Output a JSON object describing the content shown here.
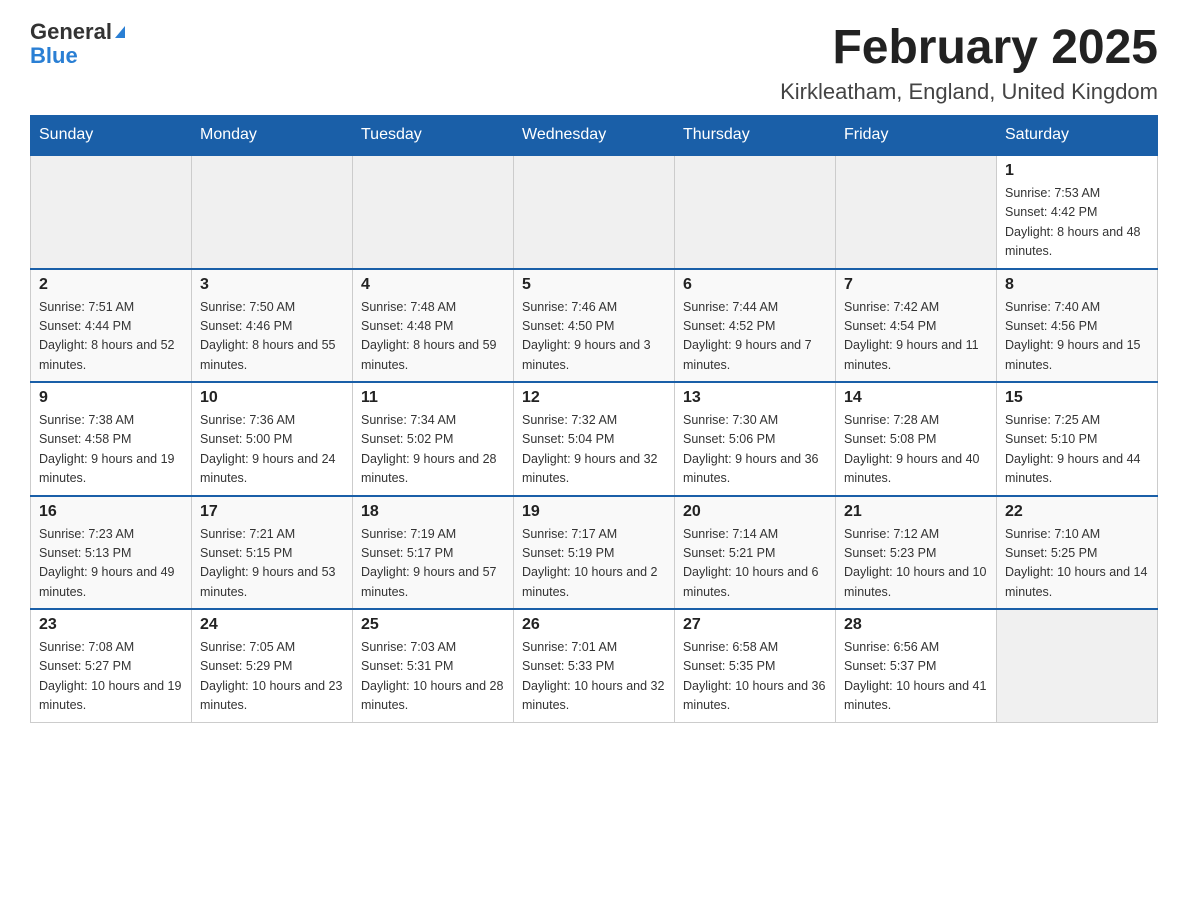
{
  "header": {
    "logo_general": "General",
    "logo_blue": "Blue",
    "title": "February 2025",
    "subtitle": "Kirkleatham, England, United Kingdom"
  },
  "calendar": {
    "days_of_week": [
      "Sunday",
      "Monday",
      "Tuesday",
      "Wednesday",
      "Thursday",
      "Friday",
      "Saturday"
    ],
    "weeks": [
      [
        {
          "date": "",
          "info": ""
        },
        {
          "date": "",
          "info": ""
        },
        {
          "date": "",
          "info": ""
        },
        {
          "date": "",
          "info": ""
        },
        {
          "date": "",
          "info": ""
        },
        {
          "date": "",
          "info": ""
        },
        {
          "date": "1",
          "info": "Sunrise: 7:53 AM\nSunset: 4:42 PM\nDaylight: 8 hours and 48 minutes."
        }
      ],
      [
        {
          "date": "2",
          "info": "Sunrise: 7:51 AM\nSunset: 4:44 PM\nDaylight: 8 hours and 52 minutes."
        },
        {
          "date": "3",
          "info": "Sunrise: 7:50 AM\nSunset: 4:46 PM\nDaylight: 8 hours and 55 minutes."
        },
        {
          "date": "4",
          "info": "Sunrise: 7:48 AM\nSunset: 4:48 PM\nDaylight: 8 hours and 59 minutes."
        },
        {
          "date": "5",
          "info": "Sunrise: 7:46 AM\nSunset: 4:50 PM\nDaylight: 9 hours and 3 minutes."
        },
        {
          "date": "6",
          "info": "Sunrise: 7:44 AM\nSunset: 4:52 PM\nDaylight: 9 hours and 7 minutes."
        },
        {
          "date": "7",
          "info": "Sunrise: 7:42 AM\nSunset: 4:54 PM\nDaylight: 9 hours and 11 minutes."
        },
        {
          "date": "8",
          "info": "Sunrise: 7:40 AM\nSunset: 4:56 PM\nDaylight: 9 hours and 15 minutes."
        }
      ],
      [
        {
          "date": "9",
          "info": "Sunrise: 7:38 AM\nSunset: 4:58 PM\nDaylight: 9 hours and 19 minutes."
        },
        {
          "date": "10",
          "info": "Sunrise: 7:36 AM\nSunset: 5:00 PM\nDaylight: 9 hours and 24 minutes."
        },
        {
          "date": "11",
          "info": "Sunrise: 7:34 AM\nSunset: 5:02 PM\nDaylight: 9 hours and 28 minutes."
        },
        {
          "date": "12",
          "info": "Sunrise: 7:32 AM\nSunset: 5:04 PM\nDaylight: 9 hours and 32 minutes."
        },
        {
          "date": "13",
          "info": "Sunrise: 7:30 AM\nSunset: 5:06 PM\nDaylight: 9 hours and 36 minutes."
        },
        {
          "date": "14",
          "info": "Sunrise: 7:28 AM\nSunset: 5:08 PM\nDaylight: 9 hours and 40 minutes."
        },
        {
          "date": "15",
          "info": "Sunrise: 7:25 AM\nSunset: 5:10 PM\nDaylight: 9 hours and 44 minutes."
        }
      ],
      [
        {
          "date": "16",
          "info": "Sunrise: 7:23 AM\nSunset: 5:13 PM\nDaylight: 9 hours and 49 minutes."
        },
        {
          "date": "17",
          "info": "Sunrise: 7:21 AM\nSunset: 5:15 PM\nDaylight: 9 hours and 53 minutes."
        },
        {
          "date": "18",
          "info": "Sunrise: 7:19 AM\nSunset: 5:17 PM\nDaylight: 9 hours and 57 minutes."
        },
        {
          "date": "19",
          "info": "Sunrise: 7:17 AM\nSunset: 5:19 PM\nDaylight: 10 hours and 2 minutes."
        },
        {
          "date": "20",
          "info": "Sunrise: 7:14 AM\nSunset: 5:21 PM\nDaylight: 10 hours and 6 minutes."
        },
        {
          "date": "21",
          "info": "Sunrise: 7:12 AM\nSunset: 5:23 PM\nDaylight: 10 hours and 10 minutes."
        },
        {
          "date": "22",
          "info": "Sunrise: 7:10 AM\nSunset: 5:25 PM\nDaylight: 10 hours and 14 minutes."
        }
      ],
      [
        {
          "date": "23",
          "info": "Sunrise: 7:08 AM\nSunset: 5:27 PM\nDaylight: 10 hours and 19 minutes."
        },
        {
          "date": "24",
          "info": "Sunrise: 7:05 AM\nSunset: 5:29 PM\nDaylight: 10 hours and 23 minutes."
        },
        {
          "date": "25",
          "info": "Sunrise: 7:03 AM\nSunset: 5:31 PM\nDaylight: 10 hours and 28 minutes."
        },
        {
          "date": "26",
          "info": "Sunrise: 7:01 AM\nSunset: 5:33 PM\nDaylight: 10 hours and 32 minutes."
        },
        {
          "date": "27",
          "info": "Sunrise: 6:58 AM\nSunset: 5:35 PM\nDaylight: 10 hours and 36 minutes."
        },
        {
          "date": "28",
          "info": "Sunrise: 6:56 AM\nSunset: 5:37 PM\nDaylight: 10 hours and 41 minutes."
        },
        {
          "date": "",
          "info": ""
        }
      ]
    ]
  }
}
